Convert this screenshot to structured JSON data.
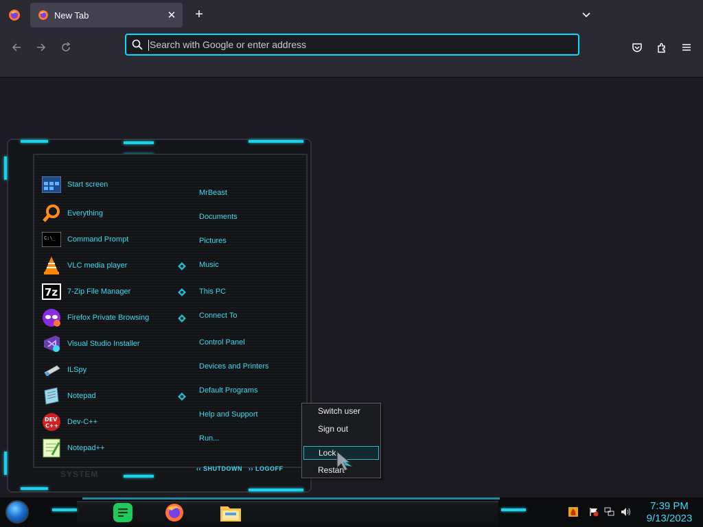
{
  "browser": {
    "tab_title": "New Tab",
    "new_tab_symbol": "+",
    "close_symbol": "✕",
    "url_placeholder": "Search with Google or enter address",
    "url_value": "",
    "accent": "#00ddff",
    "icons": [
      "firefox-view-icon",
      "back-icon",
      "forward-icon",
      "reload-icon",
      "search-icon",
      "pocket-icon",
      "extensions-icon",
      "menu-icon",
      "list-all-tabs-icon"
    ]
  },
  "start_menu": {
    "programs": [
      {
        "label": "Start screen",
        "icon": "start-screen-icon"
      },
      {
        "label": "Everything",
        "icon": "everything-icon"
      },
      {
        "label": "Command Prompt",
        "icon": "command-prompt-icon"
      },
      {
        "label": "VLC media player",
        "icon": "vlc-icon"
      },
      {
        "label": "7-Zip File Manager",
        "icon": "7zip-icon"
      },
      {
        "label": "Firefox Private Browsing",
        "icon": "firefox-private-icon"
      },
      {
        "label": "Visual Studio Installer",
        "icon": "visual-studio-installer-icon"
      },
      {
        "label": "ILSpy",
        "icon": "ilspy-icon"
      },
      {
        "label": "Notepad",
        "icon": "notepad-icon"
      },
      {
        "label": "Dev-C++",
        "icon": "devcpp-icon"
      },
      {
        "label": "Notepad++",
        "icon": "notepadpp-icon"
      }
    ],
    "places": [
      {
        "label": "MrBeast"
      },
      {
        "label": "Documents"
      },
      {
        "label": "Pictures"
      },
      {
        "label": "Music"
      },
      {
        "label": "This PC"
      },
      {
        "label": "Connect To"
      },
      {
        "label": "Control Panel"
      },
      {
        "label": "Devices and Printers"
      },
      {
        "label": "Default Programs"
      },
      {
        "label": "Help and Support"
      },
      {
        "label": "Run..."
      }
    ],
    "system_label": "SYSTEM",
    "shutdown_label": "SHUTDOWN",
    "logoff_label": "LOGOFF",
    "accent": "#3fd9f0"
  },
  "power_menu": {
    "items": [
      {
        "label": "Switch user"
      },
      {
        "label": "Sign out"
      },
      {
        "label": "Lock"
      },
      {
        "label": "Restart"
      }
    ],
    "highlighted": "Lock"
  },
  "taskbar": {
    "apps": [
      "notes-app-icon",
      "firefox-icon",
      "file-explorer-icon"
    ],
    "tray": [
      "wifi-warning-icon",
      "flag-icon",
      "network-icon",
      "volume-icon"
    ],
    "time": "7:39 PM",
    "date": "9/13/2023",
    "accent": "#3fd9f0"
  }
}
